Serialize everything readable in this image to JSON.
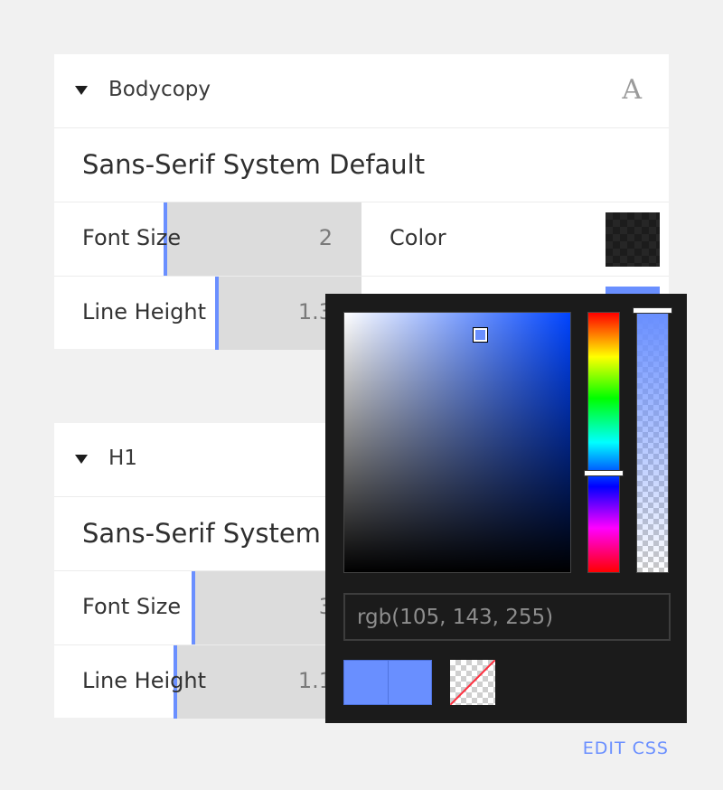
{
  "sections": [
    {
      "title": "Bodycopy",
      "font_icon_glyph": "A",
      "font_name": "Sans-Serif System Default",
      "font_size": {
        "label": "Font Size",
        "value": "2"
      },
      "line_height": {
        "label": "Line Height",
        "value": "1.3"
      },
      "color": {
        "label": "Color"
      }
    },
    {
      "title": "H1",
      "font_name": "Sans-Serif System Default",
      "font_size": {
        "label": "Font Size",
        "value": "3"
      },
      "line_height": {
        "label": "Line Height",
        "value": "1.1"
      }
    }
  ],
  "color_picker": {
    "value": "rgb(105, 143, 255)",
    "selected_color": "#698fff"
  },
  "edit_css_label": "EDIT CSS"
}
